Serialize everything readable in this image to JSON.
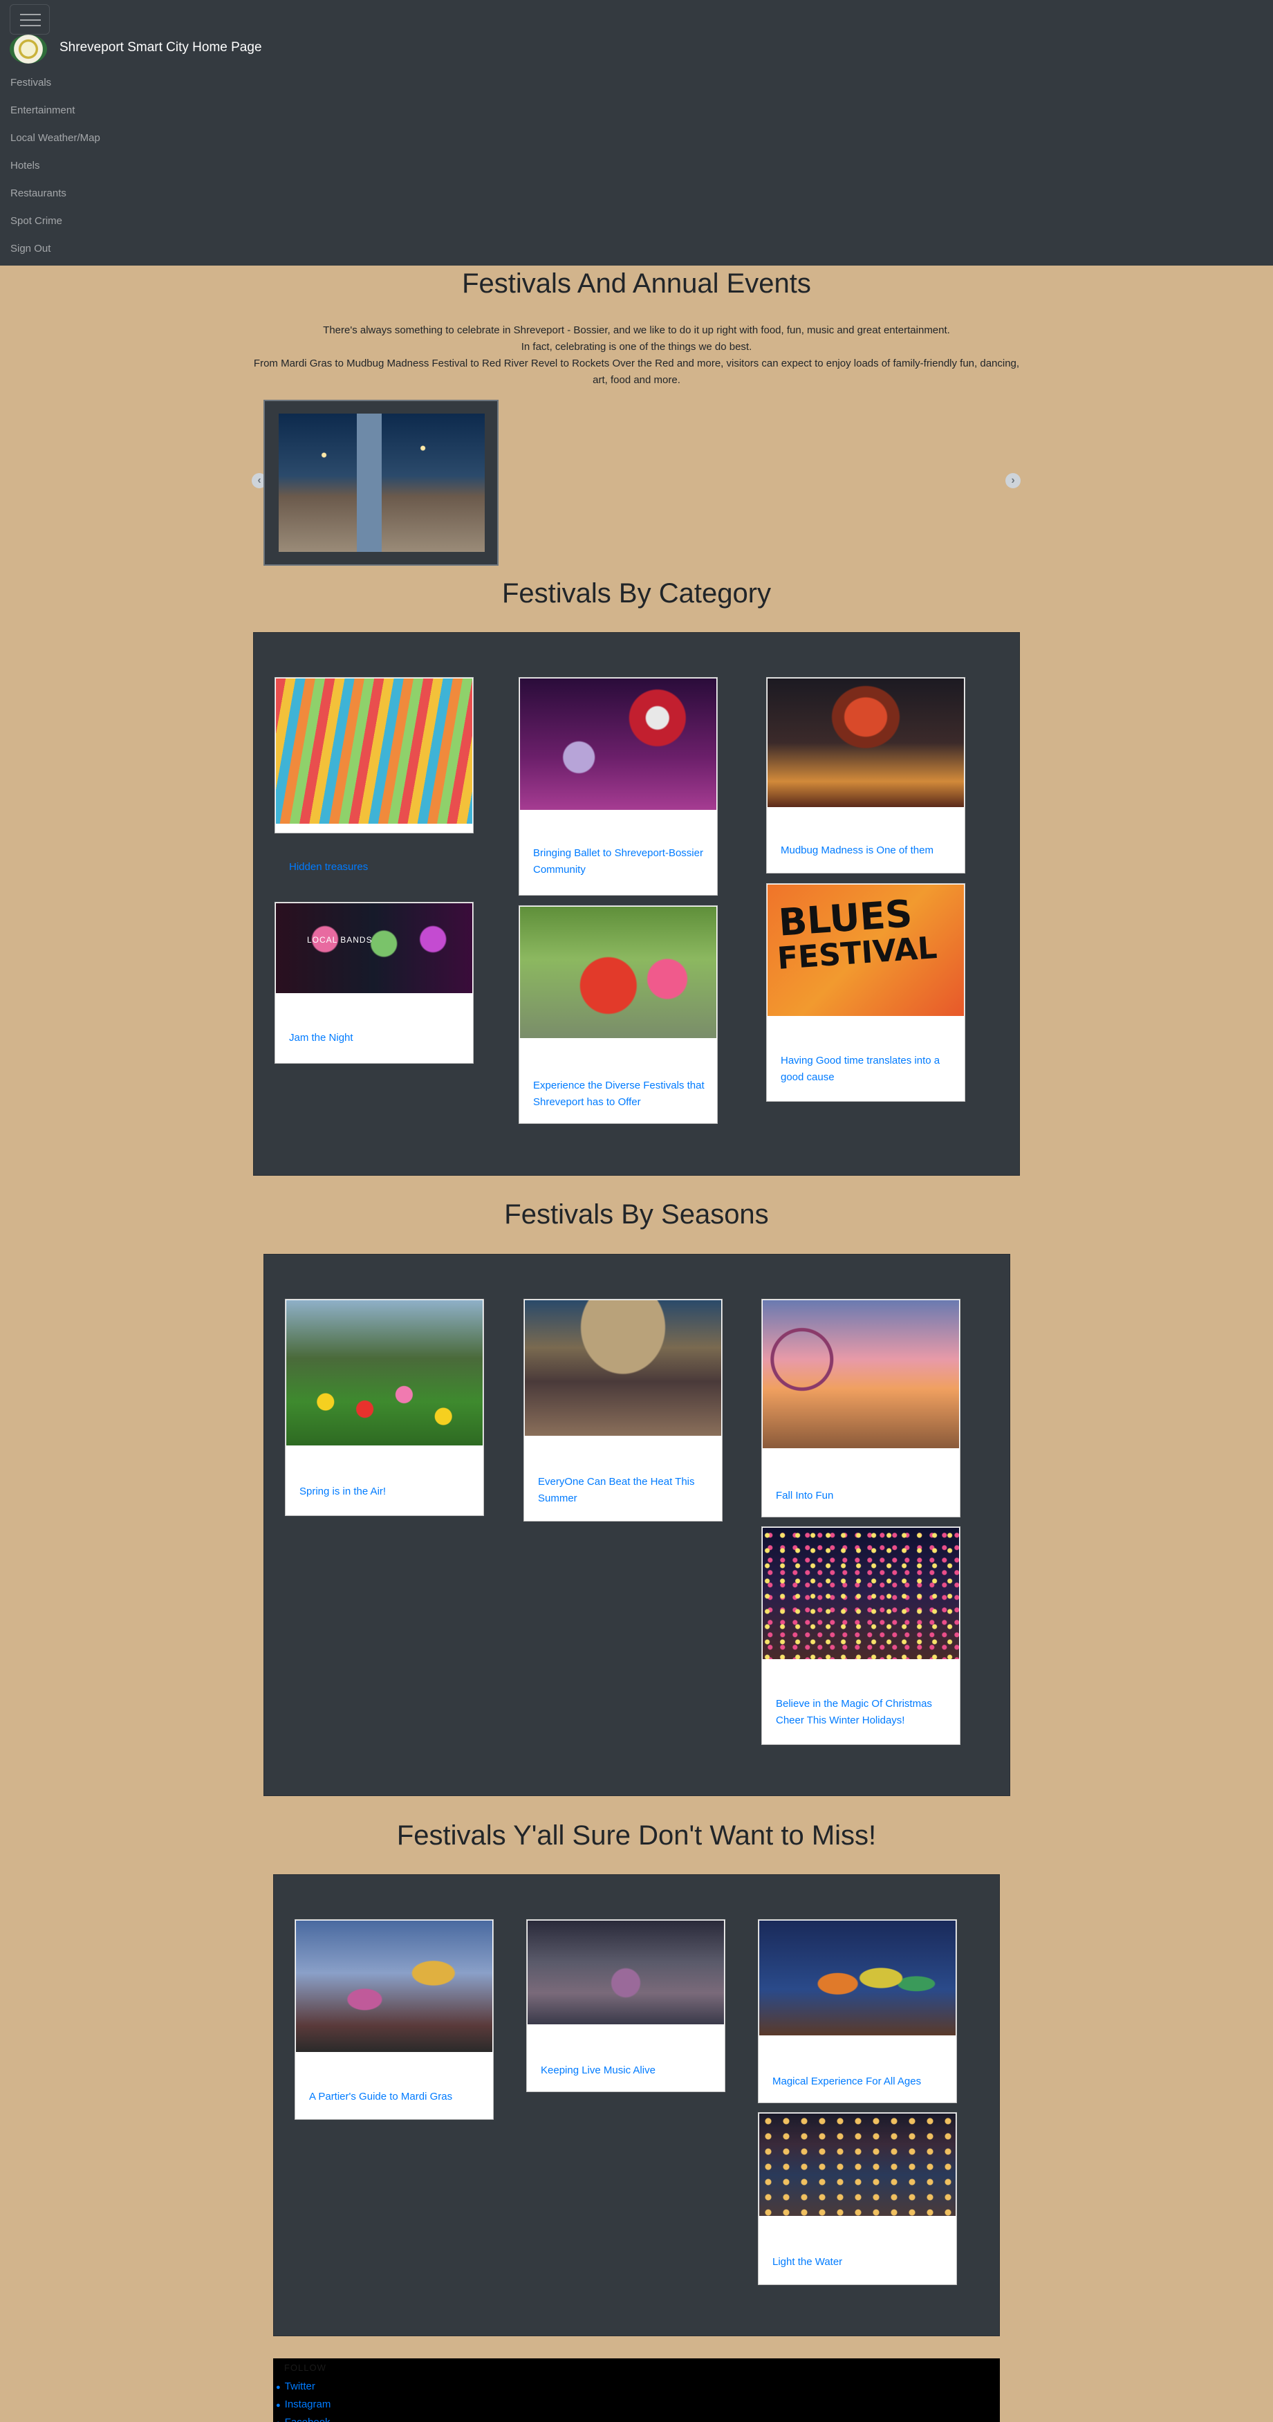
{
  "navbar": {
    "brand": "Shreveport Smart City Home Page",
    "items": [
      "Festivals",
      "Entertainment",
      "Local Weather/Map",
      "Hotels",
      "Restaurants",
      "Spot Crime",
      "Sign Out"
    ]
  },
  "intro": {
    "title": "Festivals And Annual Events",
    "line1": "There's always something to celebrate in Shreveport - Bossier, and we like to do it up right with food, fun, music and great entertainment.",
    "line2": "In fact, celebrating is one of the things we do best.",
    "line3": "From Mardi Gras to Mudbug Madness Festival to Red River Revel to Rockets Over the Red and more, visitors can expect to enjoy loads of family-friendly fun, dancing, art, food and more."
  },
  "carousel": {
    "prev": "‹",
    "next": "›"
  },
  "category": {
    "title": "Festivals By Category",
    "cards": [
      "Hidden treasures",
      "Bringing Ballet to Shreveport-Bossier Community",
      "Mudbug Madness is One of them",
      "Jam the Night",
      "Experience the Diverse Festivals that Shreveport has to Offer",
      "Having Good time translates into a good cause"
    ],
    "poster_text": {
      "local_bands": "LOCAL BANDS",
      "blues_line1": "BLUES",
      "blues_line2": "FESTIVAL"
    }
  },
  "seasons": {
    "title": "Festivals By Seasons",
    "cards": [
      "Spring is in the Air!",
      "EveryOne Can Beat the Heat This Summer",
      "Fall Into Fun",
      "Believe in the Magic Of Christmas Cheer This Winter Holidays!"
    ]
  },
  "must": {
    "title": "Festivals Y'all Sure Don't Want to Miss!",
    "cards": [
      "A Partier's Guide to Mardi Gras",
      "Keeping Live Music Alive",
      "Magical Experience For All Ages",
      "Light the Water"
    ]
  },
  "footer": {
    "follow": "FOLLOW",
    "links": [
      "Twitter",
      "Instagram",
      "Facebook"
    ]
  },
  "colors": {
    "page_bg": "#d2b48c",
    "panel_bg": "#343a40",
    "link": "#007bff",
    "navbar_bg": "#343a40"
  }
}
